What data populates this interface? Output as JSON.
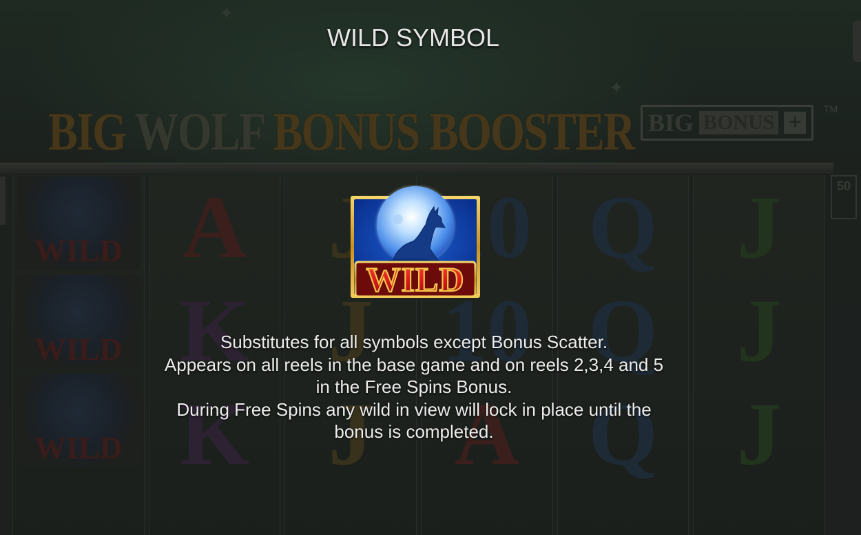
{
  "background": {
    "logo_words": [
      "BIG",
      "WOLF",
      "BONUS",
      "BOOSTER"
    ],
    "badge": {
      "big": "BIG",
      "bonus": "BONUS",
      "plus": "+",
      "tm": "TM"
    },
    "side_counter": "50",
    "reels": [
      {
        "symbols": [
          "WILD",
          "WILD",
          "WILD"
        ]
      },
      {
        "symbols": [
          "A",
          "K",
          "K"
        ]
      },
      {
        "symbols": [
          "J",
          "J",
          "J"
        ]
      },
      {
        "symbols": [
          "10",
          "10",
          "A"
        ]
      },
      {
        "symbols": [
          "Q",
          "Q",
          "Q"
        ]
      },
      {
        "symbols": [
          "J",
          "J",
          "J"
        ]
      }
    ]
  },
  "panel": {
    "title": "WILD SYMBOL",
    "symbol_label": "WILD",
    "description_lines": [
      "Substitutes for all symbols except Bonus Scatter.",
      "Appears on all reels in the base game and on reels 2,3,4 and 5",
      "in the Free Spins Bonus.",
      "During Free Spins any wild in view will lock in place until the",
      "bonus is completed."
    ]
  },
  "colors": {
    "overlay_text": "#ececec",
    "wild_red": "#d8181a",
    "wild_gold": "#e8b830",
    "moon_blue": "#2f6fd8",
    "symbol_frame_bg": "#0e3ea8"
  }
}
